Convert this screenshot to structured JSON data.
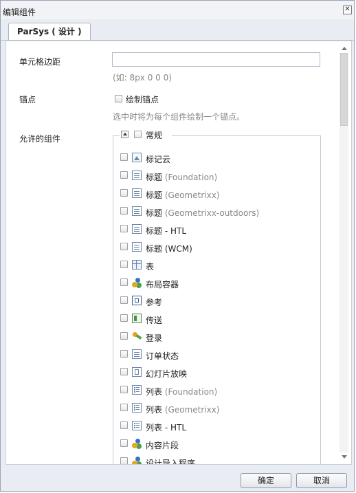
{
  "dialog": {
    "title": "编辑组件",
    "close_glyph": "✕"
  },
  "tabs": [
    {
      "label": "ParSys ( 设计 )"
    }
  ],
  "form": {
    "cell_padding_label": "单元格边距",
    "cell_padding_value": "",
    "cell_padding_hint": "(如: 8px 0 0 0)",
    "anchor_label": "锚点",
    "anchor_checkbox_label": "绘制锚点",
    "anchor_hint": "选中时将为每个组件绘制一个锚点。",
    "allowed_label": "允许的组件"
  },
  "group": {
    "name": "常规",
    "items": [
      {
        "label": "标记云",
        "sub": "",
        "icon": "image-icon"
      },
      {
        "label": "标题",
        "sub": "(Foundation)",
        "icon": "document-icon"
      },
      {
        "label": "标题",
        "sub": "(Geometrixx)",
        "icon": "document-icon"
      },
      {
        "label": "标题",
        "sub": "(Geometrixx-outdoors)",
        "icon": "document-icon"
      },
      {
        "label": "标题 - HTL",
        "sub": "",
        "icon": "document-icon"
      },
      {
        "label": "标题 (WCM)",
        "sub": "",
        "icon": "document-icon"
      },
      {
        "label": "表",
        "sub": "",
        "icon": "table-icon"
      },
      {
        "label": "布局容器",
        "sub": "",
        "icon": "component-people-icon"
      },
      {
        "label": "参考",
        "sub": "",
        "icon": "reference-icon"
      },
      {
        "label": "传送",
        "sub": "",
        "icon": "send-icon"
      },
      {
        "label": "登录",
        "sub": "",
        "icon": "login-key-icon"
      },
      {
        "label": "订单状态",
        "sub": "",
        "icon": "document-icon"
      },
      {
        "label": "幻灯片放映",
        "sub": "",
        "icon": "slideshow-icon"
      },
      {
        "label": "列表",
        "sub": "(Foundation)",
        "icon": "list-icon"
      },
      {
        "label": "列表",
        "sub": "(Geometrixx)",
        "icon": "list-icon"
      },
      {
        "label": "列表 - HTL",
        "sub": "",
        "icon": "list-icon"
      },
      {
        "label": "内容片段",
        "sub": "",
        "icon": "component-people-icon"
      },
      {
        "label": "设计导入程序",
        "sub": "",
        "icon": "component-people-icon"
      }
    ]
  },
  "footer": {
    "ok_label": "确定",
    "cancel_label": "取消"
  }
}
